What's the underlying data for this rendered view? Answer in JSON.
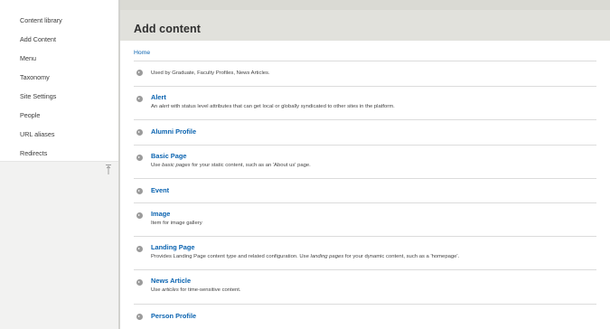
{
  "sidebar": {
    "items": [
      {
        "label": "Content library"
      },
      {
        "label": "Add Content"
      },
      {
        "label": "Menu"
      },
      {
        "label": "Taxonomy"
      },
      {
        "label": "Site Settings"
      },
      {
        "label": "People"
      },
      {
        "label": "URL aliases"
      },
      {
        "label": "Redirects"
      }
    ],
    "collapse_icon": "collapse-toggle-icon"
  },
  "header": {
    "title": "Add content"
  },
  "breadcrumb": {
    "home": "Home"
  },
  "items": [
    {
      "title": "",
      "desc_parts": [
        "Used by Graduate, Faculty Profiles, News Articles."
      ]
    },
    {
      "title": "Alert",
      "desc_parts": [
        "An ",
        "alert",
        " with status level attributes that can get local or globally syndicated to other sites in the platform."
      ]
    },
    {
      "title": "Alumni Profile",
      "desc_parts": []
    },
    {
      "title": "Basic Page",
      "desc_parts": [
        "Use ",
        "basic pages",
        " for your static content, such as an 'About us' page."
      ]
    },
    {
      "title": "Event",
      "desc_parts": []
    },
    {
      "title": "Image",
      "desc_parts": [
        "Item for image gallery"
      ]
    },
    {
      "title": "Landing Page",
      "desc_parts": [
        "Provides Landing Page content type and related configuration. Use ",
        "landing pages",
        " for your dynamic content, such as a 'homepage'."
      ]
    },
    {
      "title": "News Article",
      "desc_parts": [
        "Use ",
        "articles",
        " for time-sensitive content."
      ]
    },
    {
      "title": "Person Profile",
      "desc_parts": []
    }
  ],
  "icons": {
    "item_bullet": "circle-arrow-right-icon"
  },
  "colors": {
    "link": "#0a63b0",
    "header_bg": "#e1e1dc",
    "sidebar_bottom_bg": "#f2f2f1"
  }
}
